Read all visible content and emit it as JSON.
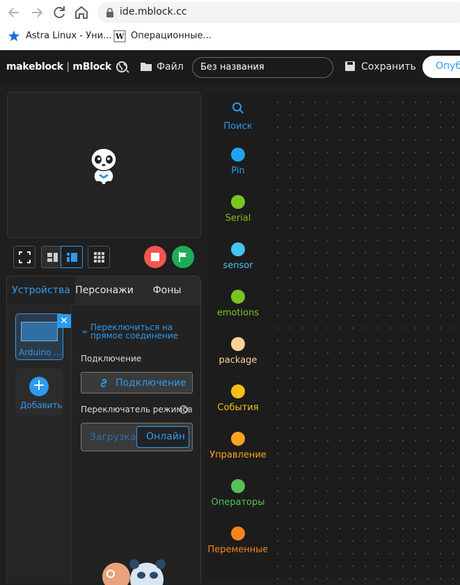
{
  "browser": {
    "url": "ide.mblock.cc",
    "bookmarks": [
      {
        "label": "Astra Linux - Уни..."
      },
      {
        "label": "Операционные..."
      }
    ]
  },
  "topbar": {
    "logo_brand": "makeblock",
    "logo_separator": "|",
    "logo_product": "mBlock",
    "file_label": "Файл",
    "project_name": "Без названия",
    "save_label": "Сохранить",
    "publish_label": "Опуб"
  },
  "sprite_tabs": [
    "Устройства",
    "Персонажи",
    "Фоны"
  ],
  "devices": {
    "device_name": "Arduino ...",
    "add_label": "Добавить",
    "switch_link_line1": "Переключиться на",
    "switch_link_line2": "прямое соединение",
    "connection_label": "Подключение",
    "connect_button": "Подключение",
    "mode_label": "Переключатель режимов",
    "mode_upload": "Загрузка",
    "mode_live": "Онлайн"
  },
  "palette": {
    "search_label": "Поиск",
    "categories": [
      {
        "label": "Pin",
        "color": "#1fa3f0"
      },
      {
        "label": "Serial",
        "color": "#7ac420"
      },
      {
        "label": "sensor",
        "color": "#45c3f3"
      },
      {
        "label": "emotions",
        "color": "#7ac420"
      },
      {
        "label": "package",
        "color": "#fdd199"
      },
      {
        "label": "События",
        "color": "#f5c014"
      },
      {
        "label": "Управление",
        "color": "#fba51c"
      },
      {
        "label": "Операторы",
        "color": "#56c157"
      },
      {
        "label": "Переменные",
        "color": "#f7841c"
      }
    ]
  },
  "colors": {
    "accent": "#2d9bef",
    "stop": "#f2564f",
    "go": "#1ead57"
  }
}
